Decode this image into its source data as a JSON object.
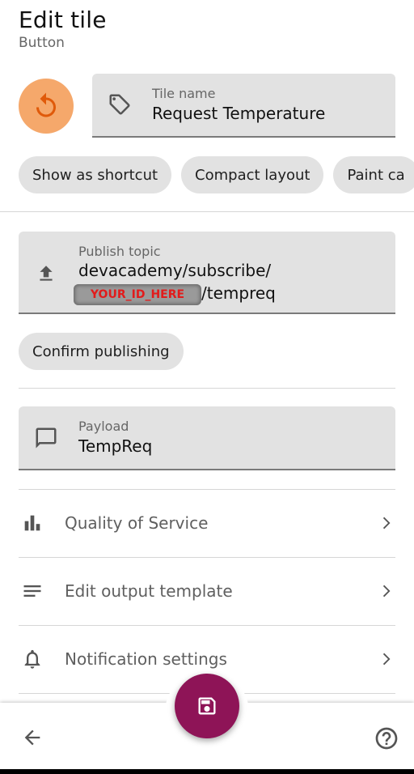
{
  "header": {
    "title": "Edit tile",
    "subtitle": "Button"
  },
  "tile_icon": {
    "name": "restart-icon",
    "color": "#f5a86b"
  },
  "tile_name": {
    "label": "Tile name",
    "value": "Request Temperature",
    "icon": "tag-icon"
  },
  "chips": [
    "Show as shortcut",
    "Compact layout",
    "Paint ca"
  ],
  "publish": {
    "label": "Publish topic",
    "value_line1": "devacademy/subscribe/",
    "redacted_text": "YOUR_ID_HERE",
    "value_line2_suffix": "/tempreq",
    "icon": "upload-icon"
  },
  "confirm_chip": "Confirm publishing",
  "payload": {
    "label": "Payload",
    "value": "TempReq",
    "icon": "message-icon"
  },
  "list": [
    {
      "label": "Quality of Service",
      "icon": "bar-chart-icon"
    },
    {
      "label": "Edit output template",
      "icon": "lines-icon"
    },
    {
      "label": "Notification settings",
      "icon": "bell-icon"
    }
  ],
  "fab": {
    "name": "save-icon",
    "color": "#8e1457"
  },
  "colors": {
    "field_bg": "#e2e2e2",
    "accent_orange": "#f5a86b",
    "fab": "#8e1457"
  }
}
